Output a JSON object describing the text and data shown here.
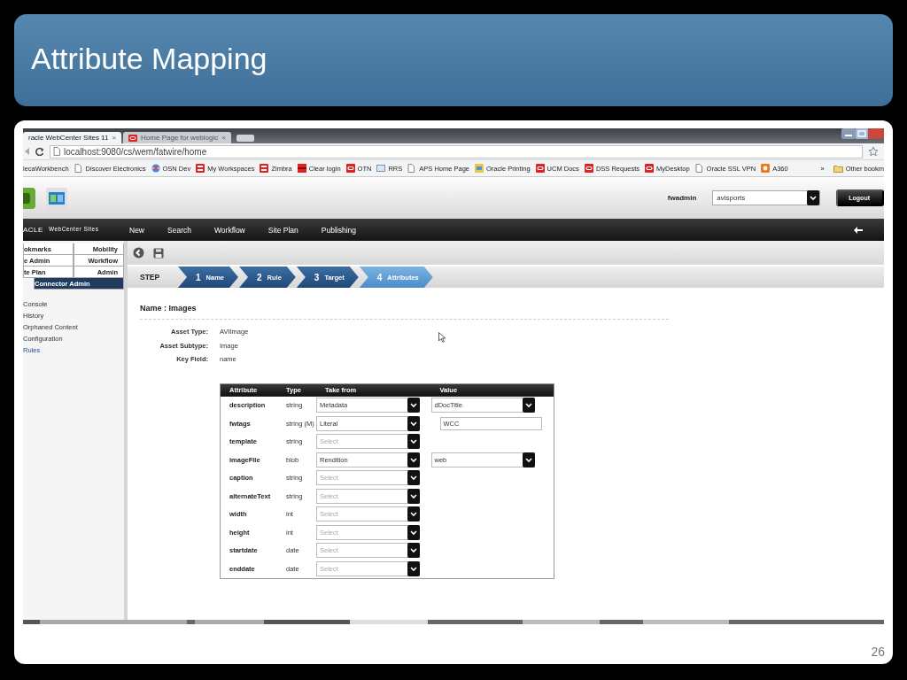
{
  "slide": {
    "title": "Attribute Mapping",
    "page_number": "26"
  },
  "browser": {
    "tabs": [
      {
        "label": "racle WebCenter Sites 11",
        "selected": true
      },
      {
        "label": "Home Page for weblogic",
        "selected": false
      }
    ],
    "close_glyph": "×",
    "address": "localhost:9080/cs/wem/fatwire/home",
    "bookmarks": [
      {
        "label": "lecaWorkbench",
        "kind": "none"
      },
      {
        "label": "Discover Electronics",
        "kind": "page"
      },
      {
        "label": "OSN Dev",
        "kind": "globe"
      },
      {
        "label": "My Workspaces",
        "kind": "workspace"
      },
      {
        "label": "Zimbra",
        "kind": "workspace"
      },
      {
        "label": "Clear login",
        "kind": "bar"
      },
      {
        "label": "OTN",
        "kind": "oracle"
      },
      {
        "label": "RRS",
        "kind": "feed"
      },
      {
        "label": "APS Home Page",
        "kind": "page"
      },
      {
        "label": "Oracle Printing",
        "kind": "printer"
      },
      {
        "label": "UCM Docs",
        "kind": "oracle"
      },
      {
        "label": "DSS Requests",
        "kind": "oracle"
      },
      {
        "label": "MyDesktop",
        "kind": "oracle"
      },
      {
        "label": "Oracle SSL VPN",
        "kind": "page"
      },
      {
        "label": "A360",
        "kind": "orange"
      }
    ],
    "more": "»",
    "other": "Other bookm"
  },
  "app": {
    "user": "fwadmin",
    "site": "avisports",
    "logout": "Logout",
    "logo": "ACLE",
    "product": "WebCenter Sites",
    "menu": [
      "New",
      "Search",
      "Workflow",
      "Site Plan",
      "Publishing"
    ]
  },
  "sidebar": {
    "tab_rows": [
      [
        {
          "label": "okmarks",
          "selected": false
        },
        {
          "label": "Mobility",
          "selected": false
        }
      ],
      [
        {
          "label": "e Admin",
          "selected": false
        },
        {
          "label": "Workflow",
          "selected": false
        }
      ],
      [
        {
          "label": "te Plan",
          "selected": false
        },
        {
          "label": "Admin",
          "selected": false
        }
      ],
      [
        {
          "label": "Connector Admin",
          "selected": true
        }
      ]
    ],
    "items": [
      {
        "label": "Console",
        "selected": false
      },
      {
        "label": "History",
        "selected": false
      },
      {
        "label": "Orphaned Content",
        "selected": false
      },
      {
        "label": "Configuration",
        "selected": false
      },
      {
        "label": "Rules",
        "selected": true
      }
    ]
  },
  "steps": {
    "label": "STEP",
    "items": [
      {
        "number": "1",
        "label": "Name",
        "selected": false
      },
      {
        "number": "2",
        "label": "Rule",
        "selected": false
      },
      {
        "number": "3",
        "label": "Target",
        "selected": false
      },
      {
        "number": "4",
        "label": "Attributes",
        "selected": true
      }
    ]
  },
  "details": {
    "heading": "Name : Images",
    "fields": [
      {
        "label": "Asset Type:",
        "value": "AVIImage"
      },
      {
        "label": "Asset Subtype:",
        "value": "Image"
      },
      {
        "label": "Key Field:",
        "value": "name"
      }
    ]
  },
  "table": {
    "columns": [
      "Attribute",
      "Type",
      "Take from",
      "Value"
    ],
    "rows": [
      {
        "attribute": "description",
        "type": "string",
        "take_from": {
          "value": "Metadata"
        },
        "value": {
          "kind": "select",
          "text": "dDocTitle"
        }
      },
      {
        "attribute": "fwtags",
        "type": "string (M)",
        "take_from": {
          "value": "Literal"
        },
        "value": {
          "kind": "input",
          "text": "WCC"
        }
      },
      {
        "attribute": "template",
        "type": "string",
        "take_from": {
          "placeholder": "Select"
        }
      },
      {
        "attribute": "imageFile",
        "type": "blob",
        "take_from": {
          "value": "Rendition"
        },
        "value": {
          "kind": "select",
          "text": "web"
        }
      },
      {
        "attribute": "caption",
        "type": "string",
        "take_from": {
          "placeholder": "Select"
        }
      },
      {
        "attribute": "alternateText",
        "type": "string",
        "take_from": {
          "placeholder": "Select"
        }
      },
      {
        "attribute": "width",
        "type": "int",
        "take_from": {
          "placeholder": "Select"
        }
      },
      {
        "attribute": "height",
        "type": "int",
        "take_from": {
          "placeholder": "Select"
        }
      },
      {
        "attribute": "startdate",
        "type": "date",
        "take_from": {
          "placeholder": "Select"
        }
      },
      {
        "attribute": "enddate",
        "type": "date",
        "take_from": {
          "placeholder": "Select"
        }
      }
    ]
  }
}
